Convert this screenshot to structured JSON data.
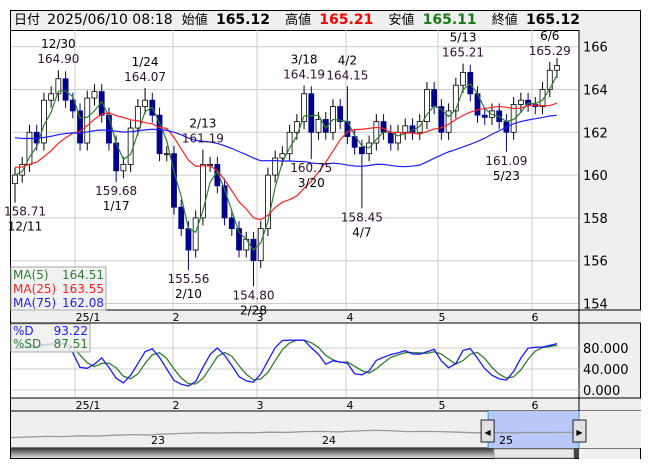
{
  "header": {
    "date_label": "日付",
    "datetime": "2025/06/10 08:18",
    "open_label": "始値",
    "open": "165.12",
    "high_label": "高値",
    "high": "165.21",
    "low_label": "安値",
    "low": "165.11",
    "close_label": "終値",
    "close": "165.12"
  },
  "colors": {
    "up_body": "#ffffff",
    "down_body": "#00008b",
    "ma5": "#2e7d32",
    "ma25": "#ff2020",
    "ma75": "#2020ff",
    "pct_d": "#1a1aff",
    "pct_sd": "#2e7d2e",
    "high_text": "#ff0000",
    "low_text": "#1a7a1a",
    "nav_fill": "#b8c8f8"
  },
  "chart_data": {
    "type": "candlestick",
    "y_ticks": [
      "166",
      "164",
      "162",
      "160",
      "158",
      "156",
      "154"
    ],
    "ylim": [
      154,
      166
    ],
    "x_ticks": [
      "25/1",
      "2",
      "3",
      "4",
      "5",
      "6"
    ],
    "closes": [
      160.0,
      160.5,
      162.0,
      161.5,
      163.5,
      163.8,
      164.5,
      163.5,
      163.0,
      161.5,
      163.6,
      163.9,
      162.8,
      161.5,
      160.2,
      160.5,
      162.2,
      163.2,
      163.5,
      162.8,
      161.0,
      161.0,
      158.5,
      157.5,
      156.5,
      158.0,
      160.5,
      160.5,
      159.5,
      158.0,
      157.5,
      156.5,
      157.0,
      156.0,
      157.5,
      160.0,
      160.8,
      161.0,
      162.0,
      162.5,
      163.8,
      162.0,
      162.6,
      162.0,
      163.2,
      162.5,
      161.8,
      161.3,
      161.0,
      161.5,
      162.5,
      162.0,
      161.5,
      162.0,
      162.3,
      162.0,
      162.5,
      164.0,
      163.2,
      162.0,
      163.0,
      164.2,
      164.8,
      163.8,
      162.8,
      162.7,
      163.0,
      162.5,
      162.0,
      163.3,
      163.5,
      163.3,
      163.2,
      164.0,
      164.9,
      165.12
    ],
    "annotations": [
      {
        "i": 0,
        "date": "12/11",
        "value": "158.71",
        "v": 158.71,
        "pos": "below"
      },
      {
        "i": 6,
        "date": "12/30",
        "value": "164.90",
        "v": 164.9,
        "pos": "above"
      },
      {
        "i": 14,
        "date": "1/17",
        "value": "159.68",
        "v": 159.68,
        "pos": "below"
      },
      {
        "i": 18,
        "date": "1/24",
        "value": "164.07",
        "v": 164.07,
        "pos": "above"
      },
      {
        "i": 24,
        "date": "2/10",
        "value": "155.56",
        "v": 155.56,
        "pos": "below"
      },
      {
        "i": 26,
        "date": "2/13",
        "value": "161.19",
        "v": 161.19,
        "pos": "above"
      },
      {
        "i": 33,
        "date": "2/28",
        "value": "154.80",
        "v": 154.8,
        "pos": "below"
      },
      {
        "i": 40,
        "date": "3/18",
        "value": "164.19",
        "v": 164.19,
        "pos": "above"
      },
      {
        "i": 41,
        "date": "3/20",
        "value": "160.75",
        "v": 160.75,
        "pos": "below"
      },
      {
        "i": 46,
        "date": "4/2",
        "value": "164.15",
        "v": 164.15,
        "pos": "above"
      },
      {
        "i": 48,
        "date": "4/7",
        "value": "158.45",
        "v": 158.45,
        "pos": "below"
      },
      {
        "i": 62,
        "date": "5/13",
        "value": "165.21",
        "v": 165.21,
        "pos": "above"
      },
      {
        "i": 68,
        "date": "5/23",
        "value": "161.09",
        "v": 161.09,
        "pos": "below"
      },
      {
        "i": 74,
        "date": "6/6",
        "value": "165.29",
        "v": 165.29,
        "pos": "above"
      }
    ],
    "legend": [
      {
        "name": "MA(5)",
        "value": "164.51"
      },
      {
        "name": "MA(25)",
        "value": "163.55"
      },
      {
        "name": "MA(75)",
        "value": "162.08"
      }
    ],
    "stochastic": {
      "y_ticks": [
        "80.000",
        "40.000",
        "0.000"
      ],
      "ylim": [
        0,
        100
      ],
      "legend": [
        {
          "name": "%D",
          "value": "93.22"
        },
        {
          "name": "%SD",
          "value": "87.51"
        }
      ]
    }
  },
  "navigator": {
    "labels": [
      "23",
      "24",
      "25"
    ],
    "series": [
      0.2,
      0.25,
      0.3,
      0.28,
      0.35,
      0.33,
      0.4,
      0.45,
      0.42,
      0.5,
      0.55,
      0.6,
      0.58,
      0.62,
      0.6,
      0.65,
      0.63,
      0.7,
      0.72,
      0.68,
      0.75,
      0.8,
      0.78,
      0.7,
      0.72,
      0.7,
      0.65,
      0.6,
      0.62,
      0.6,
      0.63,
      0.62,
      0.64,
      0.63
    ],
    "selected_fraction": [
      0.84,
      1.0
    ]
  }
}
